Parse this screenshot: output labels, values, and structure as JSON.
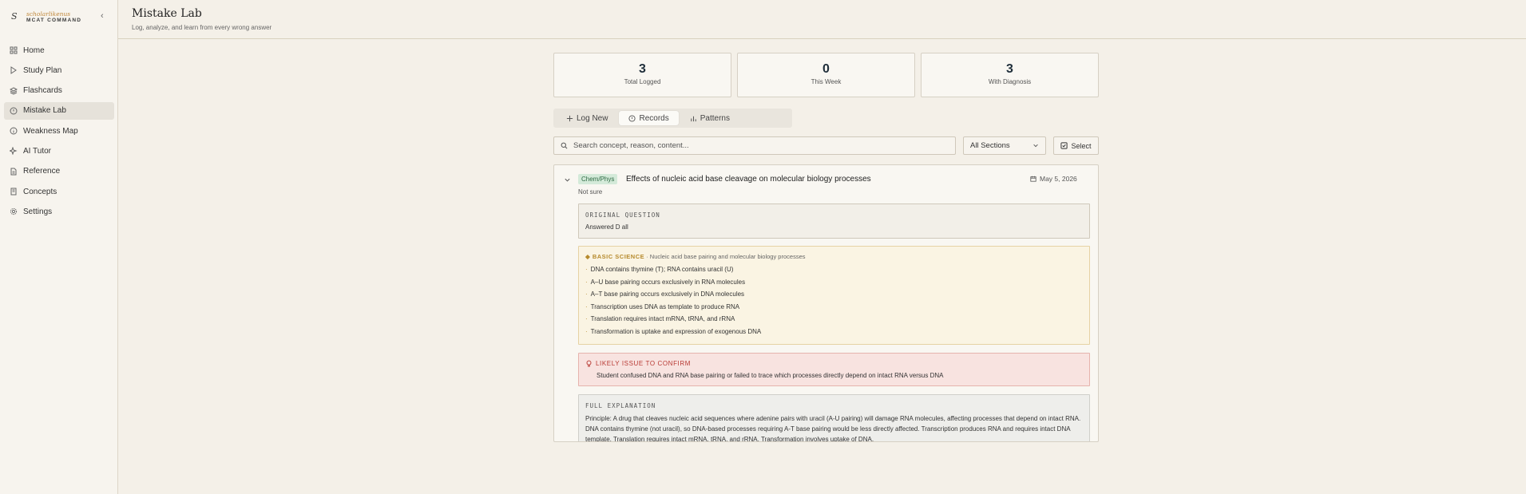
{
  "brand": {
    "logo": "S",
    "name": "scholarlikenus",
    "sub": "MCAT COMMAND"
  },
  "sidebar": {
    "items": [
      {
        "label": "Home",
        "icon": "grid-icon"
      },
      {
        "label": "Study Plan",
        "icon": "play-icon"
      },
      {
        "label": "Flashcards",
        "icon": "layers-icon"
      },
      {
        "label": "Mistake Lab",
        "icon": "alert-circle-icon",
        "active": true
      },
      {
        "label": "Weakness Map",
        "icon": "info-circle-icon"
      },
      {
        "label": "AI Tutor",
        "icon": "sparkle-icon"
      },
      {
        "label": "Reference",
        "icon": "document-icon"
      },
      {
        "label": "Concepts",
        "icon": "book-icon"
      },
      {
        "label": "Settings",
        "icon": "gear-icon"
      }
    ]
  },
  "header": {
    "title": "Mistake Lab",
    "subtitle": "Log, analyze, and learn from every wrong answer"
  },
  "stats": [
    {
      "value": "3",
      "label": "Total Logged"
    },
    {
      "value": "0",
      "label": "This Week"
    },
    {
      "value": "3",
      "label": "With Diagnosis"
    }
  ],
  "tabs": [
    {
      "label": "Log New",
      "icon": "plus-icon"
    },
    {
      "label": "Records",
      "icon": "alert-circle-icon",
      "active": true
    },
    {
      "label": "Patterns",
      "icon": "bar-chart-icon"
    }
  ],
  "search": {
    "placeholder": "Search concept, reason, content..."
  },
  "section_filter": {
    "selected": "All Sections"
  },
  "select_button": {
    "label": "Select"
  },
  "record": {
    "section": "Chem/Phys",
    "title": "Effects of nucleic acid base cleavage on molecular biology processes",
    "date": "May 5, 2026",
    "status": "Not sure",
    "original_question": {
      "heading": "ORIGINAL QUESTION",
      "body": "Answered D all"
    },
    "basic_science": {
      "heading": "◆ BASIC SCIENCE",
      "subheading": "· Nucleic acid base pairing and molecular biology processes",
      "items": [
        "DNA contains thymine (T); RNA contains uracil (U)",
        "A–U base pairing occurs exclusively in RNA molecules",
        "A–T base pairing occurs exclusively in DNA molecules",
        "Transcription uses DNA as template to produce RNA",
        "Translation requires intact mRNA, tRNA, and rRNA",
        "Transformation is uptake and expression of exogenous DNA"
      ]
    },
    "likely_issue": {
      "heading": "LIKELY ISSUE TO CONFIRM",
      "body": "Student confused DNA and RNA base pairing or failed to trace which processes directly depend on intact RNA versus DNA"
    },
    "full_explanation": {
      "heading": "FULL EXPLANATION",
      "body": "Principle: A drug that cleaves nucleic acid sequences where adenine pairs with uracil (A-U pairing) will damage RNA molecules, affecting processes that depend on intact RNA. DNA contains thymine (not uracil), so DNA-based processes requiring A-T base pairing would be less directly affected. Transcription produces RNA and requires intact DNA template. Translation requires intact mRNA, tRNA, and rRNA. Transformation involves uptake of DNA."
    }
  }
}
